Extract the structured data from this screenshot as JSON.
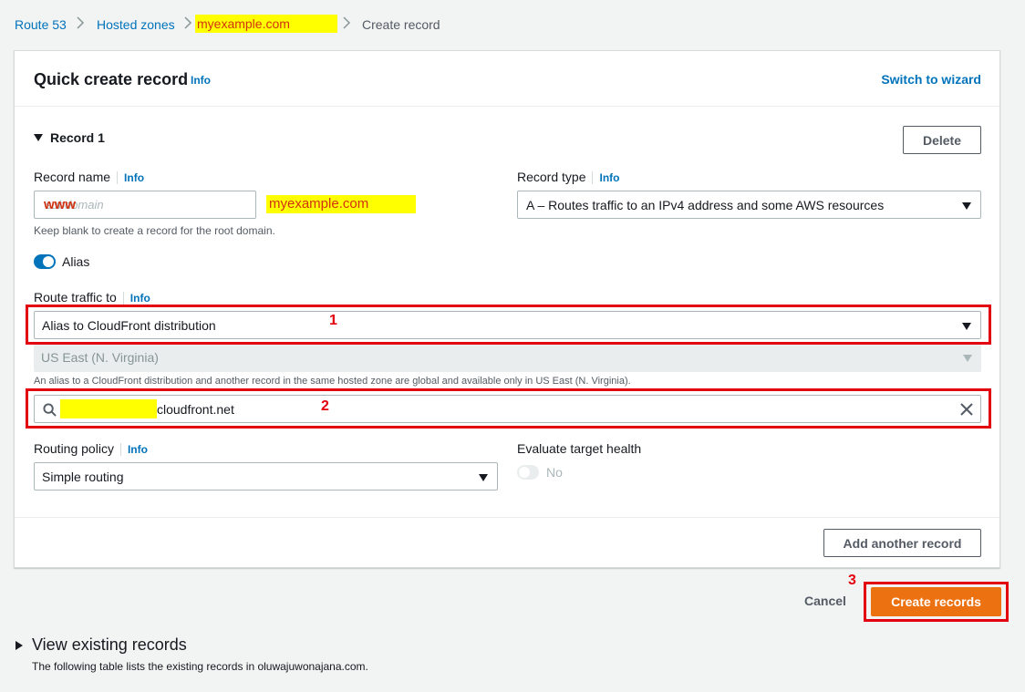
{
  "breadcrumb": {
    "items": [
      "Route 53",
      "Hosted zones",
      "myexample.com",
      "Create record"
    ]
  },
  "header": {
    "title": "Quick create record",
    "info": "Info",
    "switch_link": "Switch to wizard"
  },
  "record": {
    "section_title": "Record 1",
    "delete_label": "Delete",
    "name_label": "Record name",
    "name_info": "Info",
    "name_placeholder": "subdomain",
    "name_value": "www",
    "domain_suffix": "myexample.com",
    "name_hint": "Keep blank to create a record for the root domain.",
    "type_label": "Record type",
    "type_info": "Info",
    "type_value": "A – Routes traffic to an IPv4 address and some AWS resources",
    "alias_label": "Alias",
    "alias_on": true,
    "route_label": "Route traffic to",
    "route_info": "Info",
    "route_value": "Alias to CloudFront distribution",
    "region_value": "US East (N. Virginia)",
    "alias_note": "An alias to a CloudFront distribution and another record in the same hosted zone are global and available only in US East (N. Virginia).",
    "endpoint_value": "cloudfront.net",
    "routing_label": "Routing policy",
    "routing_info": "Info",
    "routing_value": "Simple routing",
    "eval_label": "Evaluate target health",
    "eval_value": "No",
    "add_another": "Add another record"
  },
  "actions": {
    "cancel": "Cancel",
    "create": "Create records"
  },
  "annotations": [
    "1",
    "2",
    "3"
  ],
  "existing": {
    "title": "View existing records",
    "description": "The following table lists the existing records in oluwajuwonajana.com."
  },
  "colors": {
    "primary": "#ec7211",
    "link": "#0073bb",
    "annotation": "#e3000f",
    "highlight": "#ffff00",
    "toggle": "#0073bb"
  }
}
